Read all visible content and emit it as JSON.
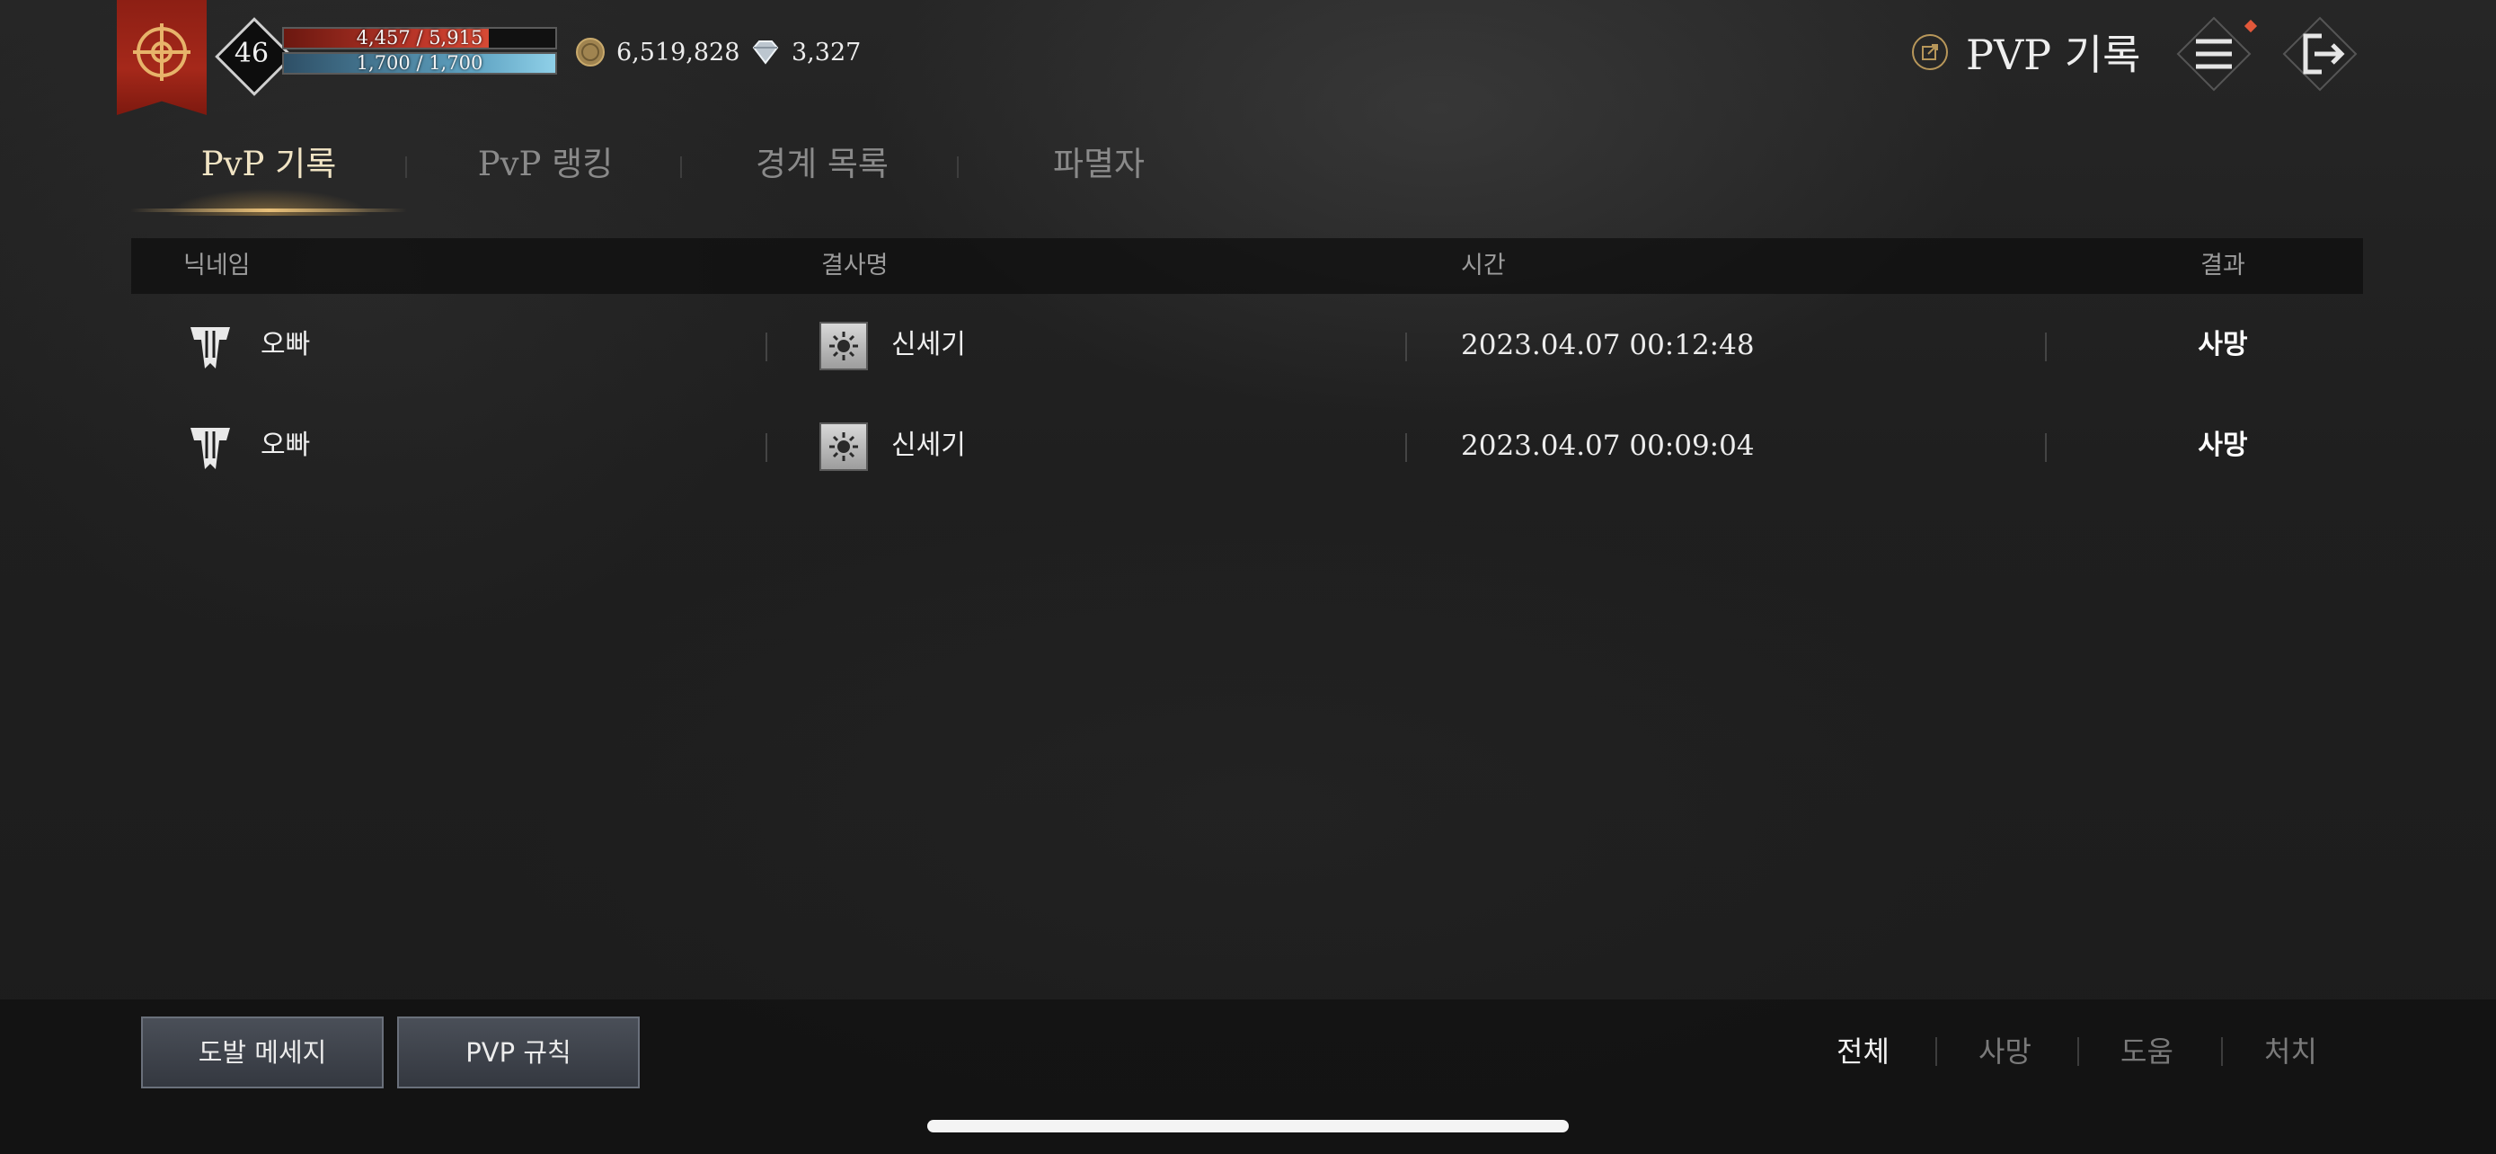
{
  "hud": {
    "level": "46",
    "hp": {
      "text": "4,457 / 5,915",
      "fraction": 0.7535
    },
    "mp": {
      "text": "1,700 / 1,700",
      "fraction": 1.0
    },
    "gold": "6,519,828",
    "gems": "3,327",
    "page_title": "PVP 기록",
    "icons": {
      "banner": "guild-banner-icon",
      "gold": "gold-coin-icon",
      "gem": "diamond-icon",
      "link": "external-link-icon",
      "menu": "hamburger-menu-icon",
      "exit": "exit-icon"
    },
    "colors": {
      "banner": "#a5281a",
      "hp": "#c0382a",
      "mp": "#5fa3c2",
      "accent": "#e8c07a",
      "notification": "#e2583a"
    }
  },
  "tabs": [
    {
      "label": "PvP 기록",
      "active": true
    },
    {
      "label": "PvP 랭킹",
      "active": false
    },
    {
      "label": "경계 목록",
      "active": false
    },
    {
      "label": "파멸자",
      "active": false
    }
  ],
  "table": {
    "headers": {
      "nickname": "닉네임",
      "guild": "결사명",
      "time": "시간",
      "result": "결과"
    },
    "rows": [
      {
        "nickname": "오빠",
        "guild": "신세기",
        "time": "2023.04.07 00:12:48",
        "result": "사망"
      },
      {
        "nickname": "오빠",
        "guild": "신세기",
        "time": "2023.04.07 00:09:04",
        "result": "사망"
      }
    ]
  },
  "footer": {
    "taunt_button": "도발 메세지",
    "rules_button": "PVP 규칙",
    "filters": [
      {
        "label": "전체",
        "active": true
      },
      {
        "label": "사망",
        "active": false
      },
      {
        "label": "도움",
        "active": false
      },
      {
        "label": "처치",
        "active": false
      }
    ]
  }
}
